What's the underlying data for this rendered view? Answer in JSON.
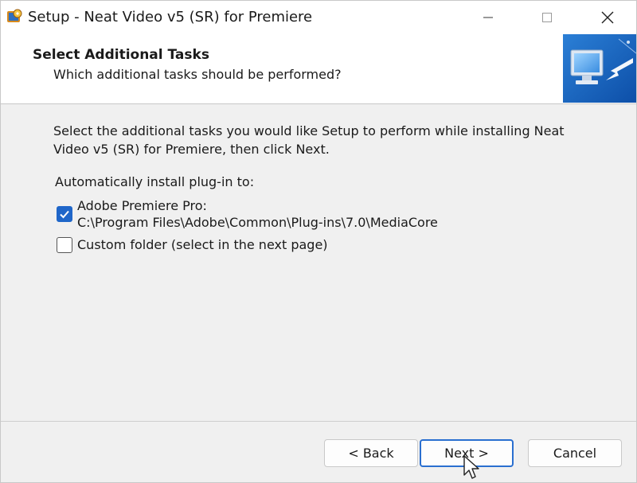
{
  "window": {
    "title": "Setup - Neat Video v5 (SR) for Premiere",
    "controls": [
      "minimize",
      "maximize",
      "close"
    ]
  },
  "header": {
    "title": "Select Additional Tasks",
    "subtitle": "Which additional tasks should be performed?",
    "image_icon": "monitor-arrow-icon"
  },
  "body": {
    "description": "Select the additional tasks you would like Setup to perform while installing Neat Video v5 (SR) for Premiere, then click Next.",
    "install_label": "Automatically install plug-in to:",
    "options": [
      {
        "label": "Adobe Premiere Pro:",
        "path": "C:\\Program Files\\Adobe\\Common\\Plug-ins\\7.0\\MediaCore",
        "checked": true
      },
      {
        "label": "Custom folder (select in the next page)",
        "checked": false
      }
    ]
  },
  "footer": {
    "back_label": "< Back",
    "next_label": "Next >",
    "cancel_label": "Cancel"
  },
  "colors": {
    "accent": "#1f66c9",
    "focus_border": "#2a6fd0"
  }
}
